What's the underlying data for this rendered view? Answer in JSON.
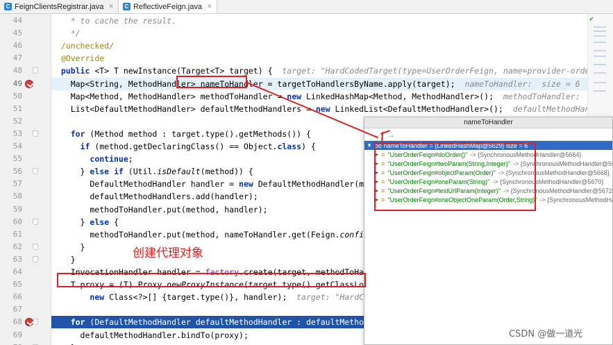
{
  "tabs": [
    {
      "label": "FeignClientsRegistrar.java",
      "active": false
    },
    {
      "label": "ReflectiveFeign.java",
      "active": true
    }
  ],
  "lines": [
    {
      "num": "44",
      "html": "    <span class=\"cm\">* to cache the result.</span>"
    },
    {
      "num": "45",
      "html": "    <span class=\"cm\">*/</span>"
    },
    {
      "num": "46",
      "html": "  <span class=\"an\">/unchecked/</span>"
    },
    {
      "num": "47",
      "html": "  <span class=\"an\">@Override</span>"
    },
    {
      "num": "48",
      "html": "  <span class=\"kw\">public</span> &lt;T&gt; T newInstance(Target&lt;T&gt; target) {  <span class=\"hint\">target: \"HardCodedTarget(type=UserOrderFeign, name=provider-order-servic</span>"
    },
    {
      "num": "49",
      "html": "    Map&lt;String, MethodHandler&gt; nameToHandler = targetToHandlersByName.apply(target);  <span class=\"hint\">nameToHandler:  size = 6  targetTo</span>"
    },
    {
      "num": "50",
      "html": "    Map&lt;Method, MethodHandler&gt; methodToHandler = <span class=\"kw\">new</span> LinkedHashMap&lt;Method, MethodHandler&gt;();  <span class=\"hint\">methodToHandler:  size = 6</span>"
    },
    {
      "num": "51",
      "html": "    List&lt;DefaultMethodHandler&gt; defaultMethodHandlers = <span class=\"kw\">new</span> LinkedList&lt;DefaultMethodHandler&gt;();  <span class=\"hint\">defaultMethodHandlers:</span>"
    },
    {
      "num": "52",
      "html": ""
    },
    {
      "num": "53",
      "html": "    <span class=\"kw\">for</span> (Method method : target.type().getMethods()) {"
    },
    {
      "num": "54",
      "html": "      <span class=\"kw\">if</span> (method.getDeclaringClass() == Object.<span class=\"kw\">class</span>) {"
    },
    {
      "num": "55",
      "html": "        <span class=\"kw\">continue</span>;"
    },
    {
      "num": "56",
      "html": "      } <span class=\"kw\">else if</span> (Util.<span class=\"ital\">isDefault</span>(method)) {"
    },
    {
      "num": "57",
      "html": "        DefaultMethodHandler handler = <span class=\"kw\">new</span> DefaultMethodHandler(method);"
    },
    {
      "num": "58",
      "html": "        defaultMethodHandlers.add(handler);"
    },
    {
      "num": "59",
      "html": "        methodToHandler.put(method, handler);"
    },
    {
      "num": "60",
      "html": "      } <span class=\"kw\">else</span> {"
    },
    {
      "num": "61",
      "html": "        methodToHandler.put(method, nameToHandler.get(Feign.<span class=\"ital\">configKey</span>(t"
    },
    {
      "num": "62",
      "html": "      }"
    },
    {
      "num": "63",
      "html": "    }"
    },
    {
      "num": "64",
      "html": "    InvocationHandler handler = <span class=\"fld\">factory</span>.create(target, methodToHandler);"
    },
    {
      "num": "65",
      "html": "    T proxy = (T) Proxy.<span class=\"ital\">newProxyInstance</span>(target.type().getClassLoader()"
    },
    {
      "num": "66",
      "html": "        <span class=\"kw\">new</span> Class&lt;?&gt;[] {target.type()}, handler);  <span class=\"hint\">target: \"HardCodedTa</span>"
    },
    {
      "num": "67",
      "html": ""
    },
    {
      "num": "68",
      "html": "    <span class=\"kw\">for</span> (DefaultMethodHandler defaultMethodHandler : defaultMethodHandl"
    },
    {
      "num": "69",
      "html": "      defaultMethodHandler.bindTo(proxy);"
    },
    {
      "num": "70",
      "html": "    }"
    }
  ],
  "popup": {
    "title": "nameToHandler",
    "nav_back": "←",
    "nav_forward": "→",
    "root": "oo nameToHandler = {LinkedHashMap@5629}  size = 6",
    "items": [
      {
        "key": "\"UserOrderFeign#doOrder()\"",
        "value": " -> {SynchronousMethodHandler@5664}"
      },
      {
        "key": "\"UserOrderFeign#twoParam(String,Integer)\"",
        "value": " -> {SynchronousMethodHandler@56"
      },
      {
        "key": "\"UserOrderFeign#objectParam(Order)\"",
        "value": " -> {SynchronousMethodHandler@5668}"
      },
      {
        "key": "\"UserOrderFeign#oneParam(String)\"",
        "value": " -> {SynchronousMethodHandler@5670}"
      },
      {
        "key": "\"UserOrderFeign#testUrlParam(Integer)\"",
        "value": " -> {SynchronousMethodHandler@5672}"
      },
      {
        "key": "\"UserOrderFeign#oneObjectOneParam(Order,String)\"",
        "value": " -> {SynchronousMethodHa"
      }
    ]
  },
  "annotation_text": "创建代理对象",
  "watermark": "CSDN @做一道光",
  "colors": {
    "accent": "#e02020",
    "exec_line": "#2154a6"
  }
}
